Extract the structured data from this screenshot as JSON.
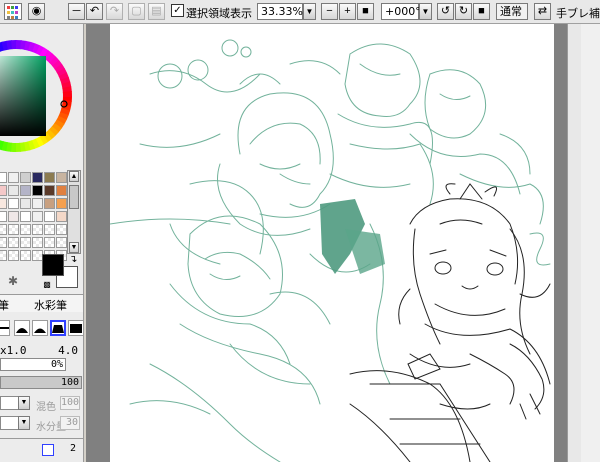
{
  "toolbar": {
    "selection_toggle_label": "選択領域表示",
    "selection_toggle_checked": "✓",
    "zoom_value": "33.33%",
    "rotation_value": "+000°",
    "blend_mode": "通常",
    "stabilizer_label": "手ブレ補正"
  },
  "brush_panel": {
    "tab_left": "筆",
    "tab_right": "水彩筆",
    "size_label": "x1.0",
    "size_value": "4.0",
    "min_size_value": "0%",
    "density_value": "100",
    "blend_label": "混色",
    "blend_value": "100",
    "dilution_label": "水分量",
    "dilution_value": "30",
    "bottom_value": "2"
  },
  "colors": {
    "primary": "#000000",
    "secondary": "#ffffff",
    "sketch": "#4f9a80",
    "palette": [
      "#ffffff",
      "#f0f0f0",
      "#cfcfcf",
      "#2a2a60",
      "#8c7b50",
      "#c8b4a0",
      "#f4c8c8",
      "#e8e8e8",
      "#b4b4c8",
      "#000000",
      "#5a3a2a",
      "#e08040",
      "#f8e8e0",
      "#ffffff",
      "#e8e8e8",
      "#f0f0f0",
      "#c8a080",
      "#f4a050",
      "#ffffff",
      "#f0e8e8",
      "#ffffff",
      "#f0f0f0",
      "#ffffff",
      "#f4d8c8"
    ]
  }
}
